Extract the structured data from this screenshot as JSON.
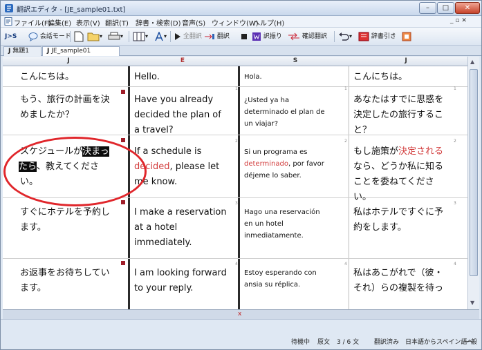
{
  "window": {
    "title": "翻訳エディタ - [JE_sample01.txt]"
  },
  "menu": [
    "ファイル(F)",
    "編集(E)",
    "表示(V)",
    "翻訳(T)",
    "辞書・検索(D)",
    "音声(S)",
    "ウィンドウ(W)",
    "ヘルプ(H)"
  ],
  "toolbar": {
    "mode": "J>S",
    "conversation_mode": "会話モード",
    "translate": "翻訳",
    "translate_all": "全翻訳",
    "back_translate": "訳振り",
    "confirm_translate": "確認翻訳",
    "dictionary": "辞書引き"
  },
  "tabs": [
    "無題1",
    "JE_sample01"
  ],
  "columns": [
    "J",
    "E",
    "S",
    "J"
  ],
  "rows": [
    {
      "num": "1",
      "jp": [
        "こんにちは。"
      ],
      "en": [
        "Hello."
      ],
      "es": [
        "Hola."
      ],
      "jp2": [
        "こんにちは。"
      ]
    },
    {
      "num": "1",
      "jp": [
        "もう、旅行の計画を決",
        "めましたか？"
      ],
      "en": [
        "Have you already",
        "decided the plan of",
        "a travel?"
      ],
      "es": [
        "¿Usted ya ha",
        "determinado el plan de",
        "un viajar?"
      ],
      "jp2": [
        "あなたはすでに思惑を",
        "決定したの旅行するこ",
        "と？"
      ]
    },
    {
      "num": "2",
      "jp_a": "スケジュールが",
      "jp_sel1": "決まっ",
      "jp_sel2": "たら",
      "jp_b": "、教えてくださ",
      "jp_c": "い。",
      "en_a": "If a schedule is",
      "en_red": "decided",
      "en_b": ", please let",
      "en_c": "me know.",
      "es_a": "Si un programa es",
      "es_red": "determinado",
      "es_b": ", por favor",
      "es_c": "déjeme lo saber.",
      "jp2_a": "もし施策が",
      "jp2_red": "決定される",
      "jp2_b": "なら、どうか私に知る",
      "jp2_c": "ことを委ねてくださ",
      "jp2_d": "い。"
    },
    {
      "num": "3",
      "jp": [
        "すぐにホテルを予約し",
        "ます。"
      ],
      "en": [
        "I make a reservation",
        "at a hotel",
        "immediately."
      ],
      "es": [
        "Hago una reservación",
        "en un hotel",
        "inmediatamente."
      ],
      "jp2": [
        "私はホテルですぐに予",
        "約をします。"
      ]
    },
    {
      "num": "4",
      "jp": [
        "お返事をお待ちしてい",
        "ます。"
      ],
      "en": [
        "I am looking forward",
        "to your reply."
      ],
      "es": [
        "Estoy esperando con",
        "ansia su réplica."
      ],
      "jp2": [
        "私はあこがれで（彼・",
        "それ）らの複製を待っ"
      ]
    }
  ],
  "status": {
    "state": "待機中",
    "source": "原文",
    "position": "3 / 6 文",
    "translated": "翻訳済み",
    "direction": "日本語からスペイン語へ",
    "mode": "一般"
  },
  "colors": {
    "selection": "#0c0c0c",
    "highlight_red": "#d23c3c",
    "annotation": "#e0262b"
  }
}
